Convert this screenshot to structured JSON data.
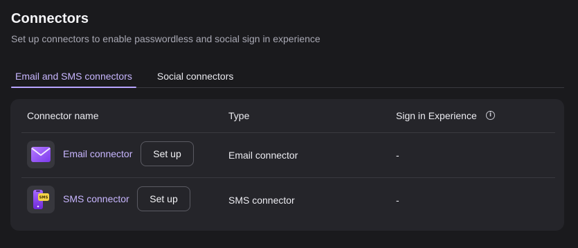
{
  "page": {
    "title": "Connectors",
    "subtitle": "Set up connectors to enable passwordless and social sign in experience"
  },
  "tabs": [
    {
      "label": "Email and SMS connectors",
      "active": true
    },
    {
      "label": "Social connectors",
      "active": false
    }
  ],
  "table": {
    "headers": {
      "name": "Connector name",
      "type": "Type",
      "sign_in_experience": "Sign in Experience"
    },
    "rows": [
      {
        "icon": "envelope-icon",
        "name": "Email connector",
        "action": "Set up",
        "type": "Email connector",
        "sign_in_experience": "-"
      },
      {
        "icon": "sms-phone-icon",
        "name": "SMS connector",
        "action": "Set up",
        "type": "SMS connector",
        "sign_in_experience": "-"
      }
    ]
  },
  "colors": {
    "background": "#1a1a1d",
    "card": "#25252a",
    "accent": "#c8b6ff",
    "icon_purple": "#9b5cf6",
    "sms_badge": "#f5d547"
  }
}
